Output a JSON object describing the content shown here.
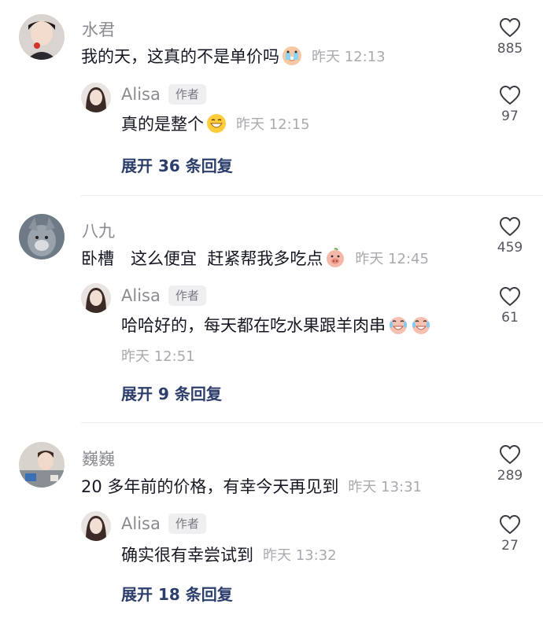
{
  "threads": [
    {
      "comment": {
        "user": "水君",
        "text": "我的天，这真的不是单价吗",
        "emoji": "crying-emoji",
        "time": "昨天 12:13",
        "likes": "885"
      },
      "reply": {
        "user": "Alisa",
        "tag": "作者",
        "text": "真的是整个",
        "emoji": "grinning-emoji",
        "time": "昨天 12:15",
        "likes": "97"
      },
      "expand": "展开 36 条回复"
    },
    {
      "comment": {
        "user": "八九",
        "text": "卧槽　这么便宜  赶紧帮我多吃点",
        "emoji": "pig-emoji",
        "time": "昨天 12:45",
        "likes": "459"
      },
      "reply": {
        "user": "Alisa",
        "tag": "作者",
        "text": "哈哈好的，每天都在吃水果跟羊肉串",
        "emoji": "laugh-cry-emoji",
        "time": "昨天 12:51",
        "likes": "61"
      },
      "expand": "展开 9 条回复"
    },
    {
      "comment": {
        "user": "巍巍",
        "text": "20 多年前的价格，有幸今天再见到",
        "time": "昨天 13:31",
        "likes": "289"
      },
      "reply": {
        "user": "Alisa",
        "tag": "作者",
        "text": "确实很有幸尝试到",
        "time": "昨天 13:32",
        "likes": "27"
      },
      "expand": "展开 18 条回复"
    }
  ]
}
